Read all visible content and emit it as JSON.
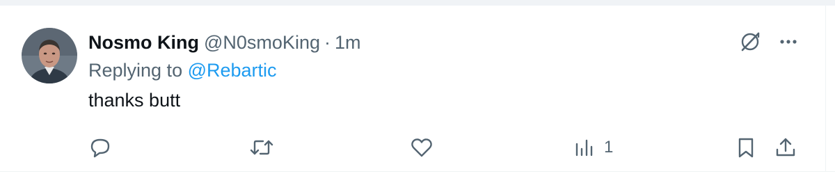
{
  "post": {
    "display_name": "Nosmo King",
    "handle": "@N0smoKing",
    "separator": "·",
    "time": "1m",
    "replying_prefix": "Replying to ",
    "replying_to": "@Rebartic",
    "text": "thanks butt"
  },
  "actions": {
    "views_count": "1"
  },
  "icons": {
    "top_right": [
      "grok-icon",
      "more-icon"
    ],
    "bar": [
      "reply-icon",
      "retweet-icon",
      "like-icon",
      "views-icon",
      "bookmark-icon",
      "share-icon"
    ]
  },
  "colors": {
    "text_primary": "#0f1419",
    "text_secondary": "#536471",
    "link": "#1d9bf0",
    "divider": "#eff3f4"
  }
}
